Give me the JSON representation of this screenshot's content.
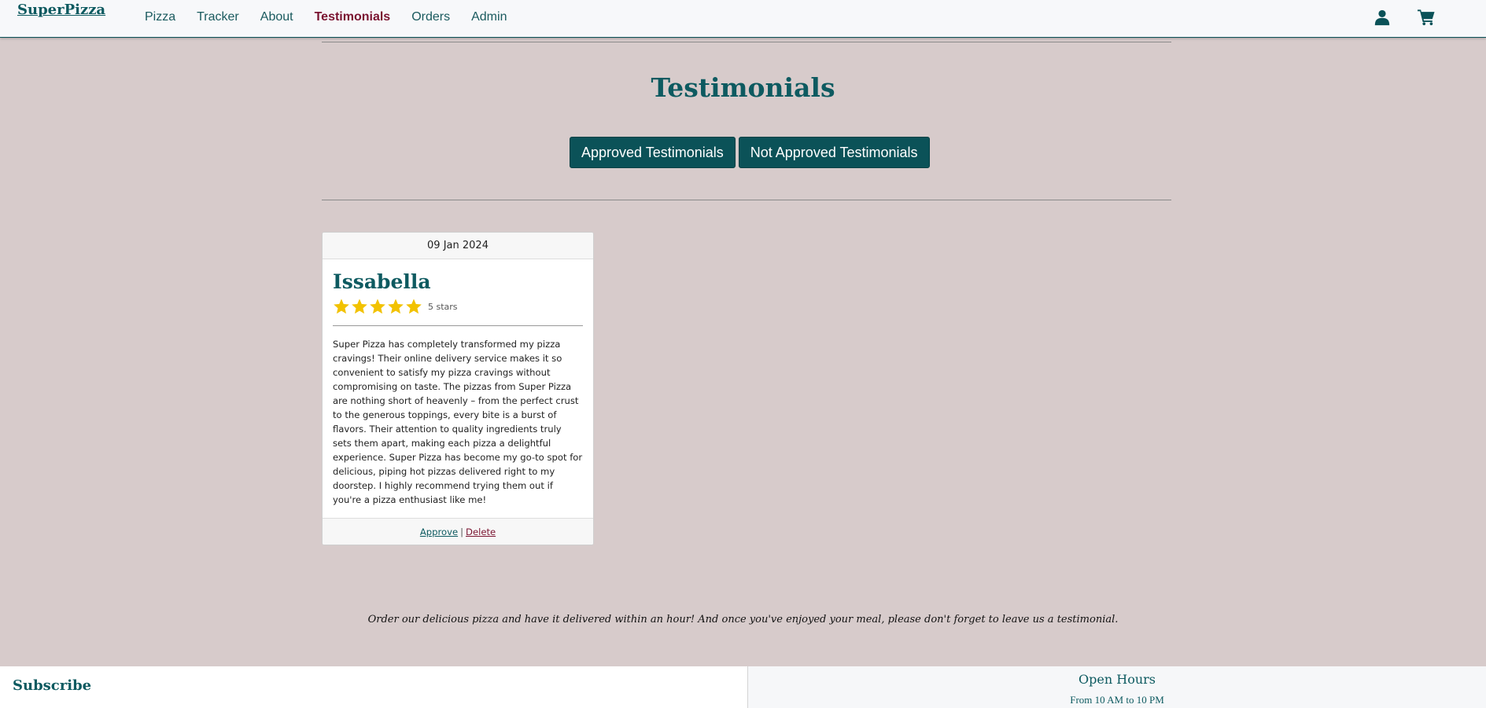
{
  "brand": "SuperPizza",
  "nav": {
    "items": [
      {
        "label": "Pizza",
        "active": false
      },
      {
        "label": "Tracker",
        "active": false
      },
      {
        "label": "About",
        "active": false
      },
      {
        "label": "Testimonials",
        "active": true
      },
      {
        "label": "Orders",
        "active": false
      },
      {
        "label": "Admin",
        "active": false
      }
    ],
    "icons": [
      "user-icon",
      "cart-icon"
    ]
  },
  "page": {
    "title": "Testimonials",
    "buttons": {
      "approved": "Approved Testimonials",
      "not_approved": "Not Approved Testimonials"
    }
  },
  "testimonial": {
    "date": "09 Jan 2024",
    "name": "Issabella",
    "rating": 5,
    "rating_label": "5 stars",
    "text": "Super Pizza has completely transformed my pizza cravings! Their online delivery service makes it so convenient to satisfy my pizza cravings without compromising on taste. The pizzas from Super Pizza are nothing short of heavenly – from the perfect crust to the generous toppings, every bite is a burst of flavors. Their attention to quality ingredients truly sets them apart, making each pizza a delightful experience. Super Pizza has become my go-to spot for delicious, piping hot pizzas delivered right to my doorstep. I highly recommend trying them out if you're a pizza enthusiast like me!",
    "approve_label": "Approve",
    "separator": "|",
    "delete_label": "Delete"
  },
  "tagline": "Order our delicious pizza and have it delivered within an hour! And once you've enjoyed your meal, please don't forget to leave us a testimonial.",
  "footer": {
    "subscribe": "Subscribe",
    "open_hours_title": "Open Hours",
    "open_hours_text": "From 10 AM to 10 PM"
  },
  "colors": {
    "primary": "#0b5258",
    "active_nav": "#7a1330",
    "background": "#d7cbcb",
    "star": "#f2c200"
  }
}
